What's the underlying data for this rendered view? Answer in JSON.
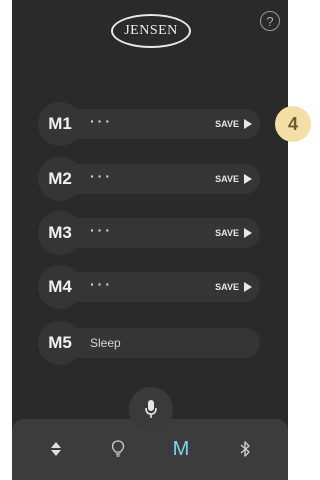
{
  "header": {
    "logo_text": "JENSEN",
    "help_icon": "question-circle-icon",
    "help_label": "?"
  },
  "memories": [
    {
      "label": "M1",
      "value": "···",
      "save": "SAVE"
    },
    {
      "label": "M2",
      "value": "···",
      "save": "SAVE"
    },
    {
      "label": "M3",
      "value": "···",
      "save": "SAVE"
    },
    {
      "label": "M4",
      "value": "···",
      "save": "SAVE"
    },
    {
      "label": "M5",
      "value": "Sleep"
    }
  ],
  "annotation": {
    "badge": "4"
  },
  "bottom_nav": {
    "mic_icon": "microphone-icon",
    "items": [
      {
        "icon": "up-down-arrows-icon"
      },
      {
        "icon": "lightbulb-icon"
      },
      {
        "icon": "m-letter-icon",
        "label": "M",
        "active": true
      },
      {
        "icon": "bluetooth-icon"
      }
    ]
  },
  "colors": {
    "background": "#2a2a2a",
    "active_accent": "#7fd4ea",
    "badge": "#f3dfa6"
  }
}
